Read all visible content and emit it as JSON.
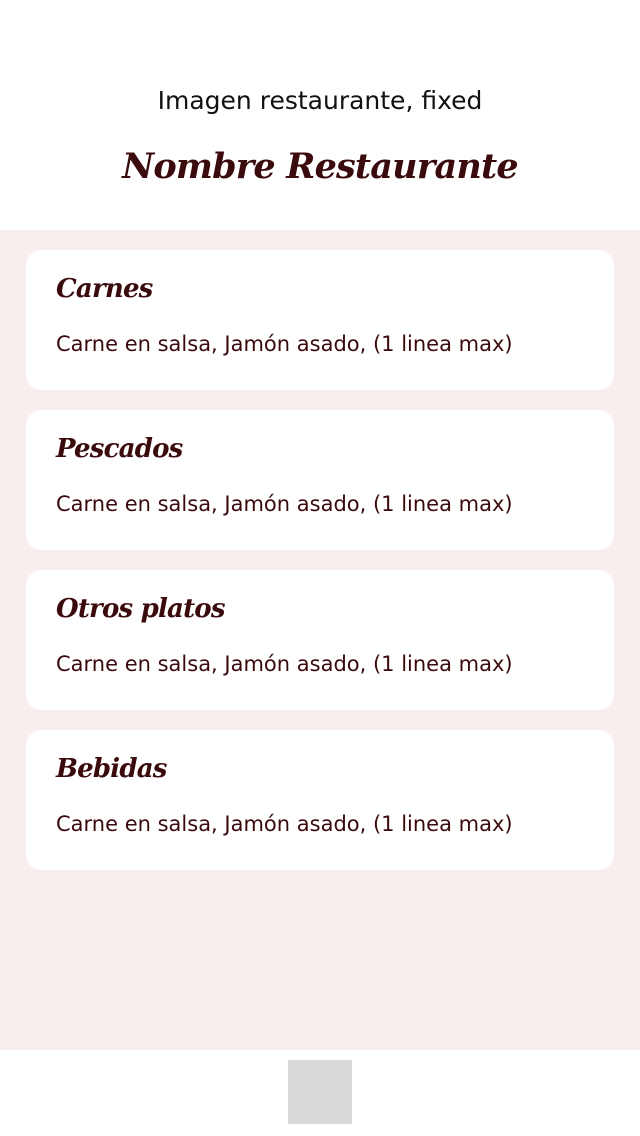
{
  "header": {
    "image_label": "Imagen restaurante, fixed",
    "title": "Nombre Restaurante"
  },
  "categories": [
    {
      "title": "Carnes",
      "description": "Carne en salsa, Jamón asado, (1 linea max)"
    },
    {
      "title": "Pescados",
      "description": "Carne en salsa, Jamón asado, (1 linea max)"
    },
    {
      "title": "Otros platos",
      "description": "Carne en salsa, Jamón asado, (1 linea max)"
    },
    {
      "title": "Bebidas",
      "description": "Carne en salsa, Jamón asado, (1 linea max)"
    }
  ],
  "colors": {
    "accent": "#3a0a0d",
    "background": "#f7efee",
    "card": "#ffffff",
    "footer_button": "#d9d9d9"
  }
}
